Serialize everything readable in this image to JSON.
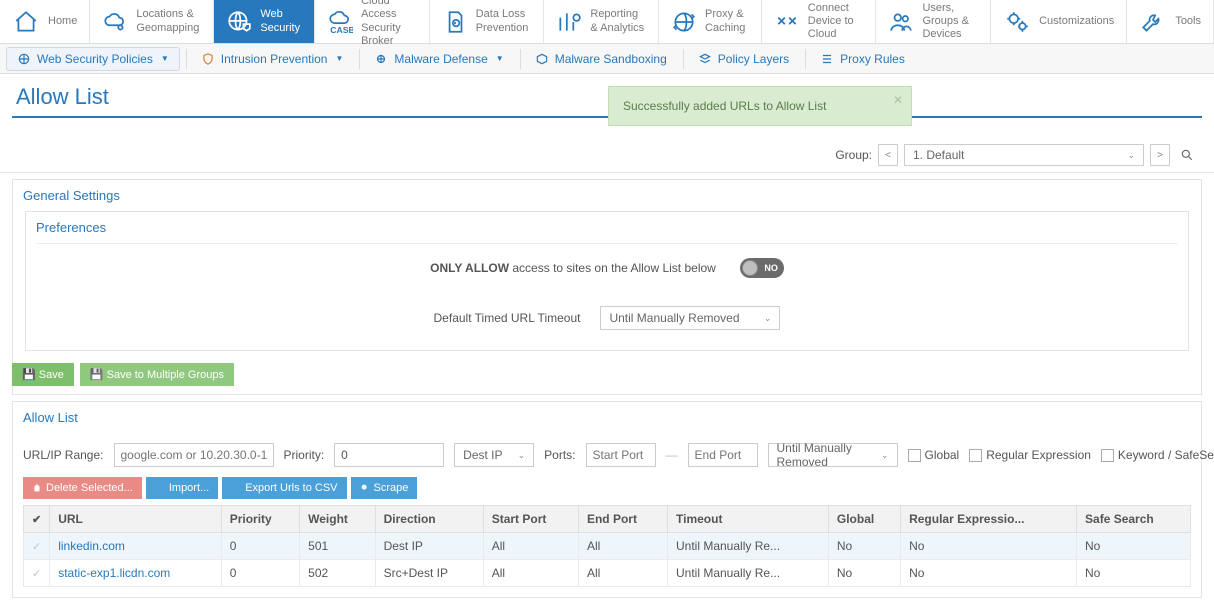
{
  "topnav": [
    {
      "label": "Home",
      "name": "nav-home"
    },
    {
      "label": "Locations & Geomapping",
      "name": "nav-locations"
    },
    {
      "label": "Web Security",
      "name": "nav-web-security",
      "active": true
    },
    {
      "label": "Cloud Access Security Broker",
      "name": "nav-casb",
      "sub": "CASB"
    },
    {
      "label": "Data Loss Prevention",
      "name": "nav-dlp"
    },
    {
      "label": "Reporting & Analytics",
      "name": "nav-reporting"
    },
    {
      "label": "Proxy & Caching",
      "name": "nav-proxy"
    },
    {
      "label": "Connect Device to Cloud",
      "name": "nav-connect"
    },
    {
      "label": "Users, Groups & Devices",
      "name": "nav-users"
    },
    {
      "label": "Customizations",
      "name": "nav-custom"
    },
    {
      "label": "Tools",
      "name": "nav-tools"
    }
  ],
  "subnav": {
    "items": [
      {
        "label": "Web Security Policies",
        "name": "sub-policies",
        "boxed": true,
        "caret": true
      },
      {
        "label": "Intrusion Prevention",
        "name": "sub-intrusion",
        "caret": true
      },
      {
        "label": "Malware Defense",
        "name": "sub-malware",
        "caret": true
      },
      {
        "label": "Malware Sandboxing",
        "name": "sub-sandbox"
      },
      {
        "label": "Policy Layers",
        "name": "sub-layers"
      },
      {
        "label": "Proxy Rules",
        "name": "sub-proxyrules"
      }
    ]
  },
  "page_title": "Allow List",
  "toast": {
    "msg": "Successfully added URLs to Allow List"
  },
  "group": {
    "label": "Group:",
    "value": "1. Default"
  },
  "general": {
    "title": "General Settings"
  },
  "prefs": {
    "title": "Preferences",
    "only_allow_bold": "ONLY ALLOW",
    "only_allow_rest": " access to sites on the Allow List below",
    "toggle_text": "NO",
    "timed_label": "Default Timed URL Timeout",
    "timed_value": "Until Manually Removed",
    "save": "Save",
    "save_multi": "Save to Multiple Groups"
  },
  "allow": {
    "title": "Allow List",
    "url_label": "URL/IP Range:",
    "url_placeholder": "google.com or 10.20.30.0-10.20.30.5",
    "prio_label": "Priority:",
    "prio_value": "0",
    "direction": "Dest IP",
    "ports_label": "Ports:",
    "start_placeholder": "Start Port",
    "end_placeholder": "End Port",
    "timeout": "Until Manually Removed",
    "global": "Global",
    "regex": "Regular Expression",
    "keyword": "Keyword / SafeSearch",
    "actions": {
      "delete": "Delete Selected...",
      "import": "Import...",
      "export": "Export Urls to CSV",
      "scrape": "Scrape"
    },
    "cols": [
      "URL",
      "Priority",
      "Weight",
      "Direction",
      "Start Port",
      "End Port",
      "Timeout",
      "Global",
      "Regular Expressio...",
      "Safe Search"
    ],
    "rows": [
      {
        "url": "linkedin.com",
        "prio": "0",
        "weight": "501",
        "dir": "Dest IP",
        "sp": "All",
        "ep": "All",
        "tmo": "Until Manually Re...",
        "g": "No",
        "rx": "No",
        "ss": "No",
        "sel": true
      },
      {
        "url": "static-exp1.licdn.com",
        "prio": "0",
        "weight": "502",
        "dir": "Src+Dest IP",
        "sp": "All",
        "ep": "All",
        "tmo": "Until Manually Re...",
        "g": "No",
        "rx": "No",
        "ss": "No"
      }
    ]
  }
}
